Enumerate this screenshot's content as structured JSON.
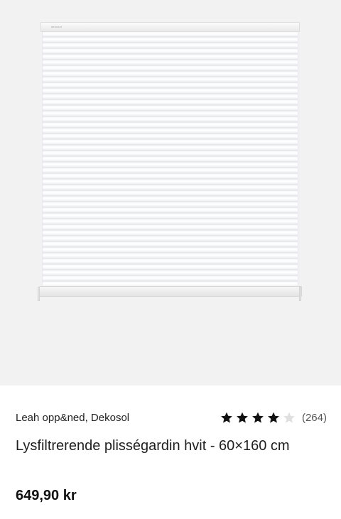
{
  "product": {
    "brand_line": "Leah opp&ned, Dekosol",
    "title": "Lysfiltrerende plisségardin hvit - 60×160 cm",
    "price": "649,90 kr",
    "rating": {
      "value": 4,
      "max": 5,
      "count_label": "(264)",
      "star_filled_color": "#111111",
      "star_empty_color": "#e0e0e0"
    },
    "image": {
      "subject": "white pleated blind",
      "logo_text": "dekosol"
    }
  }
}
